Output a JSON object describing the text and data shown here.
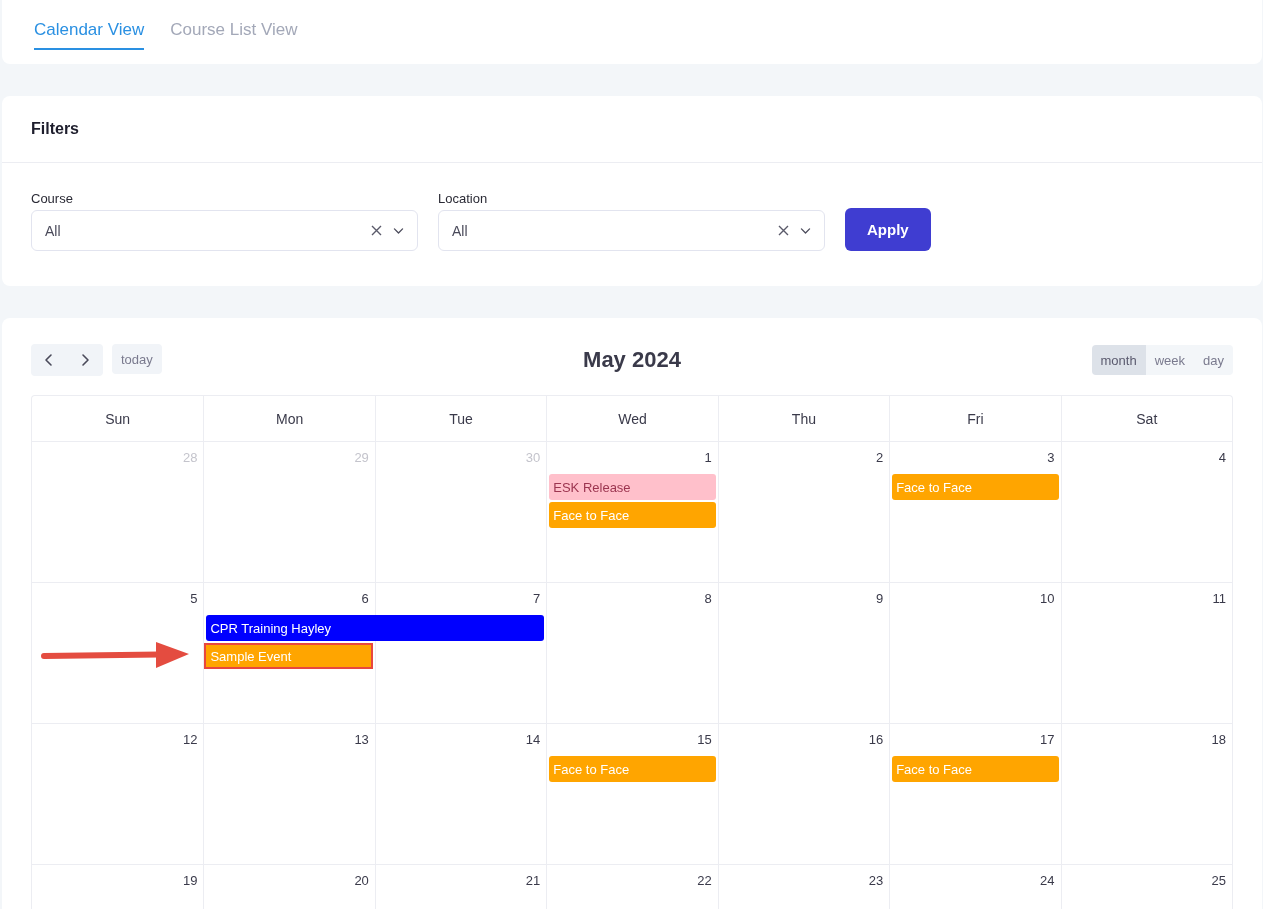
{
  "tabs": [
    {
      "label": "Calendar View",
      "selected": true
    },
    {
      "label": "Course List View",
      "selected": false
    }
  ],
  "filters": {
    "title": "Filters",
    "fields": [
      {
        "label": "Course",
        "value": "All"
      },
      {
        "label": "Location",
        "value": "All"
      }
    ],
    "apply_button": "Apply"
  },
  "calendar": {
    "title": "May 2024",
    "today_button": "today",
    "views": [
      {
        "label": "month",
        "selected": true
      },
      {
        "label": "week",
        "selected": false
      },
      {
        "label": "day",
        "selected": false
      }
    ],
    "weekdays": [
      "Sun",
      "Mon",
      "Tue",
      "Wed",
      "Thu",
      "Fri",
      "Sat"
    ],
    "weeks": [
      {
        "days": [
          {
            "number": "28",
            "other_month": true
          },
          {
            "number": "29",
            "other_month": true
          },
          {
            "number": "30",
            "other_month": true
          },
          {
            "number": "1",
            "other_month": false,
            "events": [
              {
                "title": "ESK Release",
                "color": "#ffc0cb",
                "continues_to_next": false,
                "highlighted": false
              },
              {
                "title": "Face to Face",
                "color": "#ffa500",
                "continues_to_next": false,
                "highlighted": false
              }
            ]
          },
          {
            "number": "2",
            "other_month": false
          },
          {
            "number": "3",
            "other_month": false,
            "events": [
              {
                "title": "Face to Face",
                "color": "#ffa500",
                "continues_to_next": false,
                "highlighted": false
              }
            ]
          },
          {
            "number": "4",
            "other_month": false
          }
        ]
      },
      {
        "days": [
          {
            "number": "5",
            "other_month": false
          },
          {
            "number": "6",
            "other_month": false,
            "events": [
              {
                "title": "CPR Training Hayley",
                "color": "#0000ff",
                "continues_to_next": true,
                "highlighted": false
              },
              {
                "title": "Sample Event",
                "color": "#ffa500",
                "continues_to_next": false,
                "highlighted": true
              }
            ]
          },
          {
            "number": "7",
            "other_month": false
          },
          {
            "number": "8",
            "other_month": false
          },
          {
            "number": "9",
            "other_month": false
          },
          {
            "number": "10",
            "other_month": false
          },
          {
            "number": "11",
            "other_month": false
          }
        ]
      },
      {
        "days": [
          {
            "number": "12",
            "other_month": false
          },
          {
            "number": "13",
            "other_month": false
          },
          {
            "number": "14",
            "other_month": false
          },
          {
            "number": "15",
            "other_month": false,
            "events": [
              {
                "title": "Face to Face",
                "color": "#ffa500",
                "continues_to_next": false,
                "highlighted": false
              }
            ]
          },
          {
            "number": "16",
            "other_month": false
          },
          {
            "number": "17",
            "other_month": false,
            "events": [
              {
                "title": "Face to Face",
                "color": "#ffa500",
                "continues_to_next": false,
                "highlighted": false
              }
            ]
          },
          {
            "number": "18",
            "other_month": false
          }
        ]
      },
      {
        "days": [
          {
            "number": "19",
            "other_month": false
          },
          {
            "number": "20",
            "other_month": false
          },
          {
            "number": "21",
            "other_month": false
          },
          {
            "number": "22",
            "other_month": false
          },
          {
            "number": "23",
            "other_month": false
          },
          {
            "number": "24",
            "other_month": false
          },
          {
            "number": "25",
            "other_month": false
          }
        ]
      }
    ]
  }
}
